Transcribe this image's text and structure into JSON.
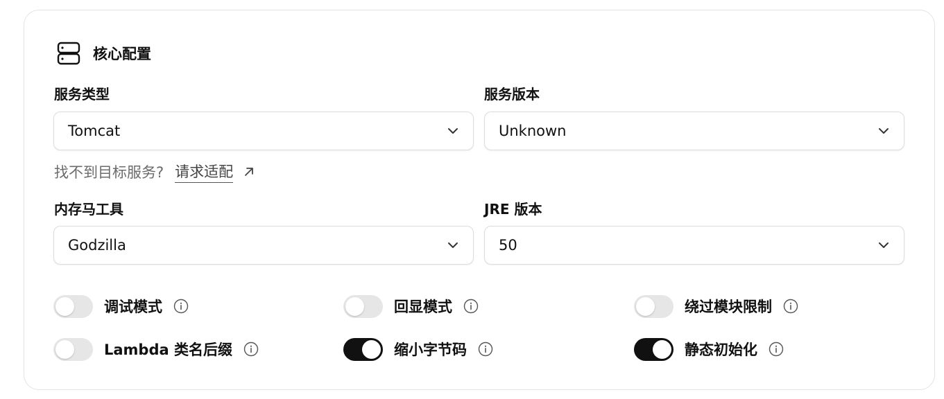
{
  "section": {
    "title": "核心配置",
    "icon": "server-icon"
  },
  "fields": {
    "service_type": {
      "label": "服务类型",
      "value": "Tomcat"
    },
    "service_version": {
      "label": "服务版本",
      "value": "Unknown"
    },
    "memshell_tool": {
      "label": "内存马工具",
      "value": "Godzilla"
    },
    "jre_version": {
      "label": "JRE 版本",
      "value": "50"
    }
  },
  "help": {
    "text": "找不到目标服务?",
    "link": "请求适配"
  },
  "toggles": [
    {
      "label": "调试模式",
      "on": false
    },
    {
      "label": "回显模式",
      "on": false
    },
    {
      "label": "绕过模块限制",
      "on": false
    },
    {
      "label": "Lambda 类名后缀",
      "on": false
    },
    {
      "label": "缩小字节码",
      "on": true
    },
    {
      "label": "静态初始化",
      "on": true
    }
  ],
  "colors": {
    "switch_on": "#111111",
    "switch_off": "#e6e6e6",
    "border": "#dcdcdc"
  }
}
